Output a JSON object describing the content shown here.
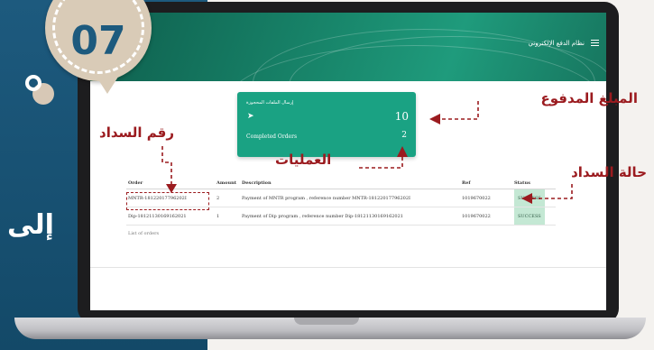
{
  "step": {
    "number": "07"
  },
  "background": {
    "partial_text": "إلى"
  },
  "app": {
    "title": "نظام الدفع الإلكتروني",
    "menu_icon": "hamburger-icon"
  },
  "card": {
    "arabic_label": "إرسال الملفات المحجوزة",
    "send_icon": "paper-plane-icon",
    "count": "10",
    "completed_label": "Completed Orders",
    "completed_value": "2"
  },
  "orders": {
    "headers": {
      "order": "Order",
      "amount": "Amount",
      "description": "Description",
      "ref": "Ref",
      "status": "Status"
    },
    "rows": [
      {
        "order": "MNTR-18122017796202I",
        "amount": "2",
        "description": "Payment of MNTR program , reference number MNTR-18122017796202I",
        "ref": "1019670022",
        "status": "SUCCESS"
      },
      {
        "order": "Dip-18121130169162021",
        "amount": "1",
        "description": "Payment of Dip program , reference number Dip-18121130169162021",
        "ref": "1019670022",
        "status": "SUCCESS"
      }
    ],
    "footer": "List of orders"
  },
  "annotations": {
    "paid_amount": "المبلغ المدفوع",
    "payment_ref": "رقم السداد",
    "operations": "العمليات",
    "payment_status": "حالة السداد"
  },
  "colors": {
    "header_green": "#18856a",
    "card_green": "#1aa283",
    "annotation_red": "#9b1b1f",
    "side_blue": "#1d5a7e",
    "badge_beige": "#d9cbb7"
  }
}
